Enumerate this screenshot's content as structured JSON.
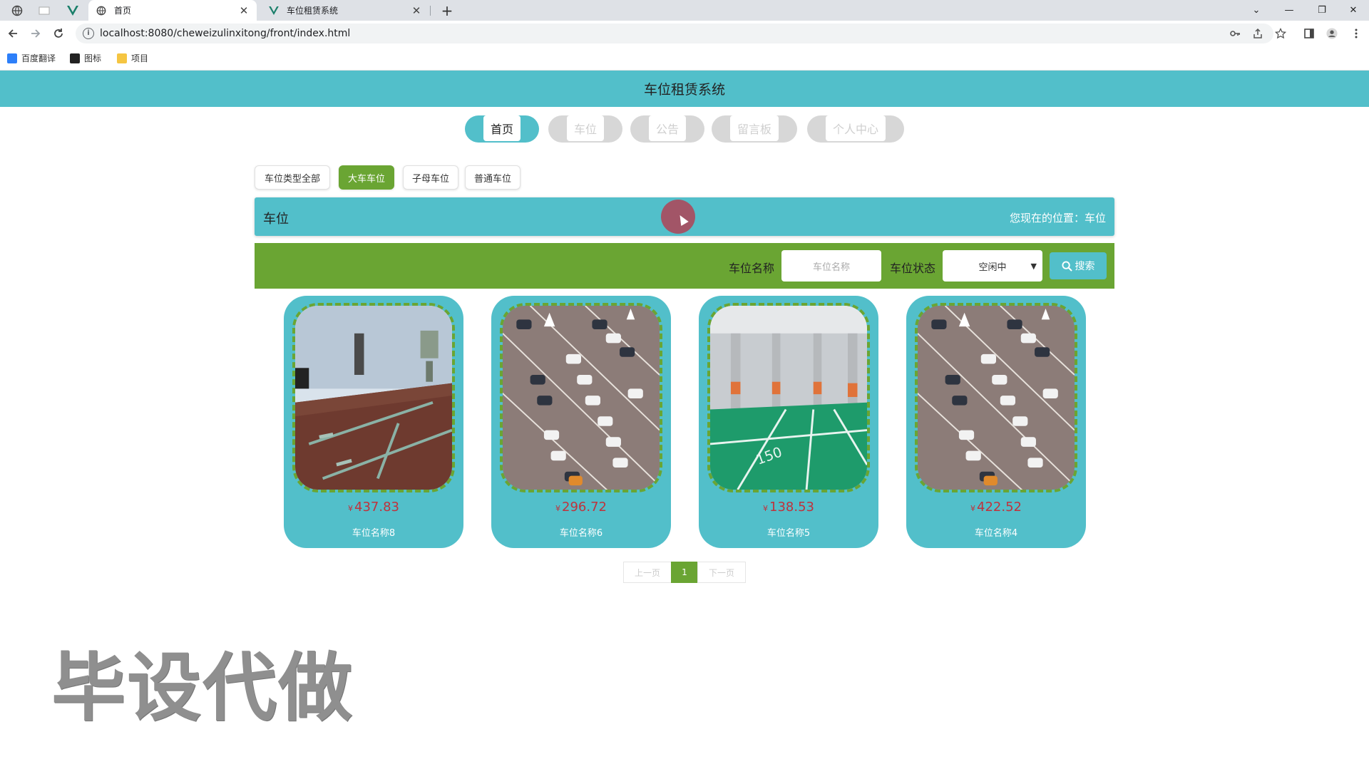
{
  "browser": {
    "tabs": [
      {
        "title": "首页",
        "active": true
      },
      {
        "title": "车位租赁系统",
        "active": false
      }
    ],
    "url": "localhost:8080/cheweizulinxitong/front/index.html",
    "bookmarks": [
      "百度翻译",
      "图标",
      "项目"
    ],
    "window_controls": {
      "dropdown": "⌄",
      "minimize": "—",
      "restore": "❐",
      "close": "✕"
    }
  },
  "header": {
    "title": "车位租赁系统"
  },
  "nav": [
    {
      "label": "首页",
      "active": true
    },
    {
      "label": "车位",
      "active": false
    },
    {
      "label": "公告",
      "active": false
    },
    {
      "label": "留言板",
      "active": false
    },
    {
      "label": "个人中心",
      "active": false
    }
  ],
  "filters": [
    {
      "label": "车位类型全部",
      "active": false
    },
    {
      "label": "大车车位",
      "active": true
    },
    {
      "label": "子母车位",
      "active": false
    },
    {
      "label": "普通车位",
      "active": false
    }
  ],
  "section": {
    "title": "车位",
    "location_label": "您现在的位置：",
    "location_value": "车位"
  },
  "search": {
    "name_label": "车位名称",
    "name_placeholder": "车位名称",
    "status_label": "车位状态",
    "status_value": "空闲中",
    "button_label": "搜索"
  },
  "cards": [
    {
      "currency": "¥",
      "price": "437.83",
      "name": "车位名称8",
      "image": "garage-interior"
    },
    {
      "currency": "¥",
      "price": "296.72",
      "name": "车位名称6",
      "image": "aerial-parking-lot"
    },
    {
      "currency": "¥",
      "price": "138.53",
      "name": "车位名称5",
      "image": "green-underground-garage"
    },
    {
      "currency": "¥",
      "price": "422.52",
      "name": "车位名称4",
      "image": "aerial-parking-lot"
    }
  ],
  "pagination": {
    "prev": "上一页",
    "current": "1",
    "next": "下一页"
  },
  "watermark": "毕设代做",
  "colors": {
    "primary": "#52bfca",
    "green": "#6aa533",
    "price": "#c0323c"
  }
}
